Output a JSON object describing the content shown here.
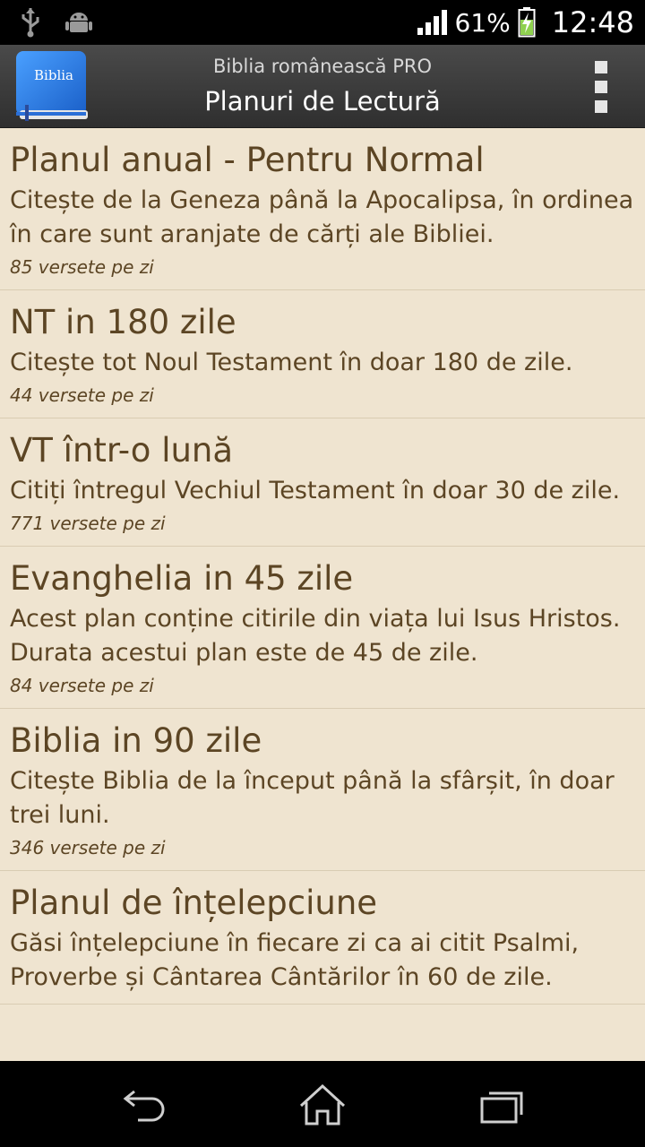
{
  "status_bar": {
    "battery_text": "61%",
    "clock": "12:48",
    "icons": [
      "usb-icon",
      "android-debug-icon",
      "signal-icon",
      "battery-charging-icon"
    ]
  },
  "action_bar": {
    "logo_text": "Biblia",
    "subtitle": "Biblia românească PRO",
    "title": "Planuri de Lectură",
    "overflow_icon": "overflow-menu-icon"
  },
  "plans": [
    {
      "title": "Planul anual - Pentru Normal",
      "description": "Citește de la Geneza până la Apocalipsa, în ordinea în care sunt aranjate de cărți ale Bibliei.",
      "verses": "85 versete pe zi"
    },
    {
      "title": "NT in 180 zile",
      "description": "Citește tot Noul Testament în doar 180 de zile.",
      "verses": "44 versete pe zi"
    },
    {
      "title": "VT într-o lună",
      "description": "Citiți întregul Vechiul Testament în doar 30 de zile.",
      "verses": "771 versete pe zi"
    },
    {
      "title": "Evanghelia in 45 zile",
      "description": "Acest plan conține citirile din viața lui Isus Hristos. Durata acestui plan este de 45 de zile.",
      "verses": "84 versete pe zi"
    },
    {
      "title": "Biblia in 90 zile",
      "description": "Citește Biblia de la început până la sfârșit, în doar trei luni.",
      "verses": "346 versete pe zi"
    },
    {
      "title": "Planul de înțelepciune",
      "description": "Găsi înțelepciune în fiecare zi ca ai citit Psalmi, Proverbe și Cântarea Cântărilor în 60 de zile.",
      "verses": ""
    }
  ],
  "nav_bar": {
    "icons": [
      "back-icon",
      "home-icon",
      "recent-apps-icon"
    ]
  },
  "colors": {
    "content_bg": "#efe4d0",
    "text": "#5c4524",
    "action_bar": "#3a3a3a"
  }
}
